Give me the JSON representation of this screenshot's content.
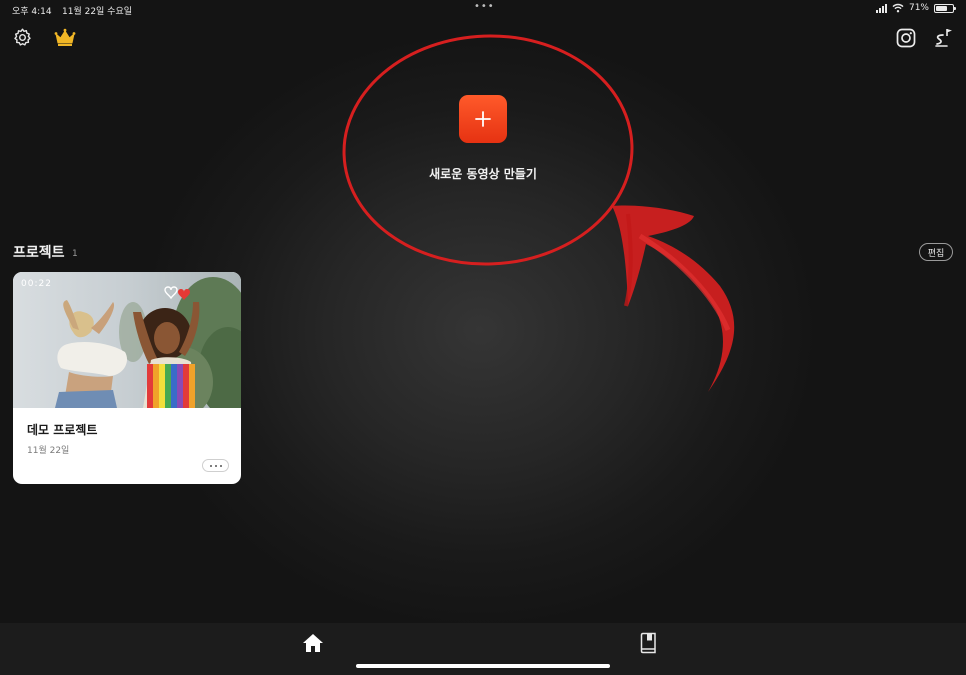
{
  "status_bar": {
    "time": "오후 4:14",
    "date": "11월 22일 수요일",
    "battery": "71%",
    "battery_level": 0.71
  },
  "header": {
    "icons": [
      "gear-icon",
      "crown-icon",
      "instagram-icon",
      "music-icon"
    ]
  },
  "new_video": {
    "label": "새로운 동영상 만들기",
    "button_symbol": "+"
  },
  "projects": {
    "title": "프로젝트",
    "count": "1",
    "edit_label": "편집",
    "items": [
      {
        "duration": "00:22",
        "title": "데모 프로젝트",
        "date": "11월 22일"
      }
    ]
  },
  "bottom_nav": {
    "items": [
      "home-icon",
      "book-icon"
    ]
  },
  "colors": {
    "accent": "#f2401a",
    "annotation": "#d61f1f",
    "background": "#111111"
  }
}
